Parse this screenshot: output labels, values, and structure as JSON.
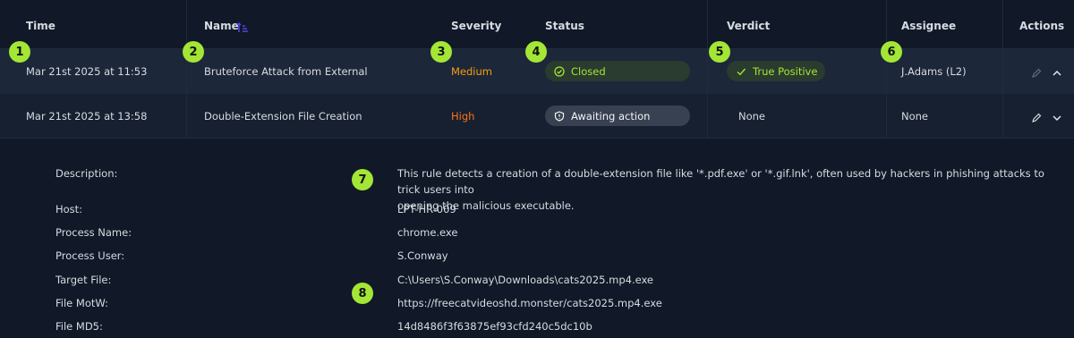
{
  "header": {
    "time": "Time",
    "name": "Name",
    "severity": "Severity",
    "status": "Status",
    "verdict": "Verdict",
    "assignee": "Assignee",
    "actions": "Actions"
  },
  "rows": [
    {
      "time": "Mar 21st 2025 at 11:53",
      "name": "Bruteforce Attack from External",
      "severity": "Medium",
      "status": "Closed",
      "verdict": "True Positive",
      "assignee": "J.Adams (L2)"
    },
    {
      "time": "Mar 21st 2025 at 13:58",
      "name": "Double-Extension File Creation",
      "severity": "High",
      "status": "Awaiting action",
      "verdict": "None",
      "assignee": "None"
    }
  ],
  "details": {
    "description_label": "Description:",
    "description_line1": "This rule detects a creation of a double-extension file like '*.pdf.exe' or '*.gif.lnk', often used by hackers in phishing attacks to trick users into",
    "description_line2": "opening the malicious executable.",
    "fields": [
      {
        "label": "Host:",
        "value": "LPT-HR-009"
      },
      {
        "label": "Process Name:",
        "value": "chrome.exe"
      },
      {
        "label": "Process User:",
        "value": "S.Conway"
      },
      {
        "label": "Target File:",
        "value": "C:\\Users\\S.Conway\\Downloads\\cats2025.mp4.exe"
      },
      {
        "label": "File MotW:",
        "value": "https://freecatvideoshd.monster/cats2025.mp4.exe"
      },
      {
        "label": "File MD5:",
        "value": "14d8486f3f63875ef93cfd240c5dc10b"
      }
    ]
  },
  "badges": [
    "1",
    "2",
    "3",
    "4",
    "5",
    "6",
    "7",
    "8"
  ],
  "colors": {
    "accent": "#a3e635",
    "medium": "#f59e0b",
    "high": "#f97316",
    "sort_icon": "#4f46e5"
  },
  "icons": {
    "sort": "sort-ascending-icon",
    "closed": "check-circle-icon",
    "awaiting": "shield-alert-icon",
    "verdict": "check-icon",
    "edit": "pencil-icon",
    "collapse": "chevron-up-icon",
    "expand": "chevron-down-icon"
  }
}
